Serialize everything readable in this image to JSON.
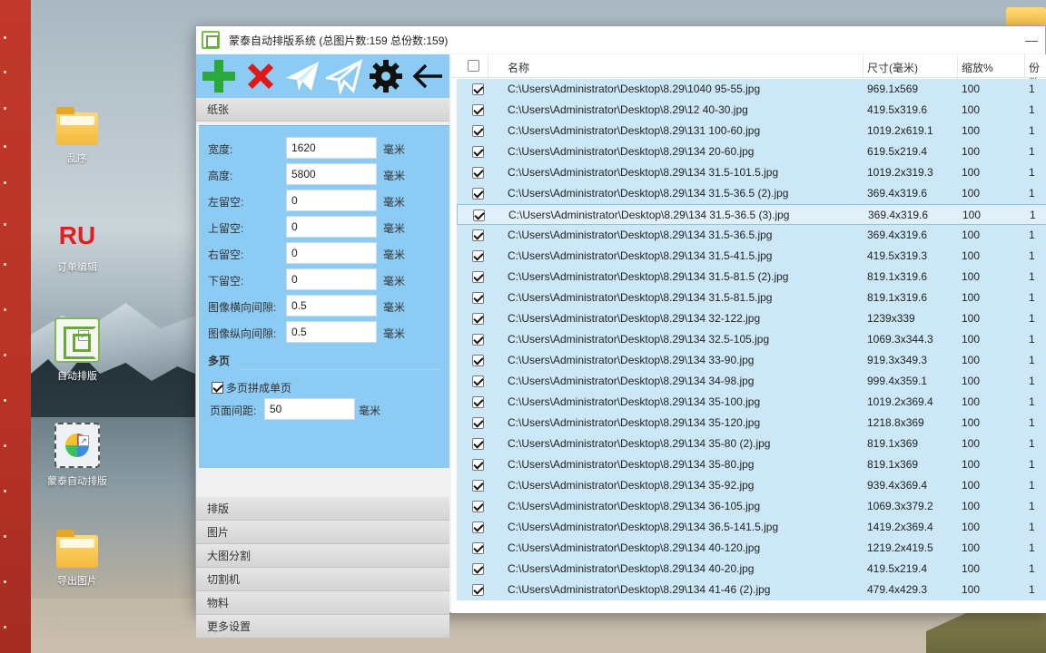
{
  "window": {
    "title": "蒙泰自动排版系统 (总图片数:159 总份数:159)",
    "minimize_glyph": "—"
  },
  "toolbar": {
    "buttons": [
      {
        "icon": "plus-icon",
        "color": "#2aa83a"
      },
      {
        "icon": "close-x-icon",
        "color": "#e01818"
      },
      {
        "icon": "send-icon",
        "color": "#ffffff"
      },
      {
        "icon": "send-outline-icon",
        "color": "#ffffff"
      },
      {
        "icon": "gear-icon",
        "color": "#111111"
      },
      {
        "icon": "arrow-left-icon",
        "color": "#111111"
      }
    ]
  },
  "paper": {
    "header": "纸张",
    "fields": [
      {
        "label": "宽度:",
        "value": "1620",
        "unit": "毫米"
      },
      {
        "label": "高度:",
        "value": "5800",
        "unit": "毫米"
      },
      {
        "label": "左留空:",
        "value": "0",
        "unit": "毫米"
      },
      {
        "label": "上留空:",
        "value": "0",
        "unit": "毫米"
      },
      {
        "label": "右留空:",
        "value": "0",
        "unit": "毫米"
      },
      {
        "label": "下留空:",
        "value": "0",
        "unit": "毫米"
      },
      {
        "label": "图像横向间隙:",
        "value": "0.5",
        "unit": "毫米"
      },
      {
        "label": "图像纵向间隙:",
        "value": "0.5",
        "unit": "毫米"
      }
    ],
    "multipage": {
      "title": "多页",
      "checkbox_label": "多页拼成单页",
      "checked": true,
      "gap_label": "页面间距:",
      "gap_value": "50",
      "gap_unit": "毫米"
    }
  },
  "sections": [
    "排版",
    "图片",
    "大图分割",
    "切割机",
    "物料",
    "更多设置"
  ],
  "list": {
    "headers": {
      "name": "名称",
      "size": "尺寸(毫米)",
      "scale": "缩放%",
      "copies": "份数"
    },
    "rows": [
      {
        "name": "C:\\Users\\Administrator\\Desktop\\8.29\\1040 95-55.jpg",
        "size": "969.1x569",
        "scale": "100",
        "copies": "1"
      },
      {
        "name": "C:\\Users\\Administrator\\Desktop\\8.29\\12 40-30.jpg",
        "size": "419.5x319.6",
        "scale": "100",
        "copies": "1"
      },
      {
        "name": "C:\\Users\\Administrator\\Desktop\\8.29\\131 100-60.jpg",
        "size": "1019.2x619.1",
        "scale": "100",
        "copies": "1"
      },
      {
        "name": "C:\\Users\\Administrator\\Desktop\\8.29\\134 20-60.jpg",
        "size": "619.5x219.4",
        "scale": "100",
        "copies": "1"
      },
      {
        "name": "C:\\Users\\Administrator\\Desktop\\8.29\\134 31.5-101.5.jpg",
        "size": "1019.2x319.3",
        "scale": "100",
        "copies": "1"
      },
      {
        "name": "C:\\Users\\Administrator\\Desktop\\8.29\\134 31.5-36.5 (2).jpg",
        "size": "369.4x319.6",
        "scale": "100",
        "copies": "1"
      },
      {
        "name": "C:\\Users\\Administrator\\Desktop\\8.29\\134 31.5-36.5 (3).jpg",
        "size": "369.4x319.6",
        "scale": "100",
        "copies": "1"
      },
      {
        "name": "C:\\Users\\Administrator\\Desktop\\8.29\\134 31.5-36.5.jpg",
        "size": "369.4x319.6",
        "scale": "100",
        "copies": "1"
      },
      {
        "name": "C:\\Users\\Administrator\\Desktop\\8.29\\134 31.5-41.5.jpg",
        "size": "419.5x319.3",
        "scale": "100",
        "copies": "1"
      },
      {
        "name": "C:\\Users\\Administrator\\Desktop\\8.29\\134 31.5-81.5 (2).jpg",
        "size": "819.1x319.6",
        "scale": "100",
        "copies": "1"
      },
      {
        "name": "C:\\Users\\Administrator\\Desktop\\8.29\\134 31.5-81.5.jpg",
        "size": "819.1x319.6",
        "scale": "100",
        "copies": "1"
      },
      {
        "name": "C:\\Users\\Administrator\\Desktop\\8.29\\134 32-122.jpg",
        "size": "1239x339",
        "scale": "100",
        "copies": "1"
      },
      {
        "name": "C:\\Users\\Administrator\\Desktop\\8.29\\134 32.5-105.jpg",
        "size": "1069.3x344.3",
        "scale": "100",
        "copies": "1"
      },
      {
        "name": "C:\\Users\\Administrator\\Desktop\\8.29\\134 33-90.jpg",
        "size": "919.3x349.3",
        "scale": "100",
        "copies": "1"
      },
      {
        "name": "C:\\Users\\Administrator\\Desktop\\8.29\\134 34-98.jpg",
        "size": "999.4x359.1",
        "scale": "100",
        "copies": "1"
      },
      {
        "name": "C:\\Users\\Administrator\\Desktop\\8.29\\134 35-100.jpg",
        "size": "1019.2x369.4",
        "scale": "100",
        "copies": "1"
      },
      {
        "name": "C:\\Users\\Administrator\\Desktop\\8.29\\134 35-120.jpg",
        "size": "1218.8x369",
        "scale": "100",
        "copies": "1"
      },
      {
        "name": "C:\\Users\\Administrator\\Desktop\\8.29\\134 35-80 (2).jpg",
        "size": "819.1x369",
        "scale": "100",
        "copies": "1"
      },
      {
        "name": "C:\\Users\\Administrator\\Desktop\\8.29\\134 35-80.jpg",
        "size": "819.1x369",
        "scale": "100",
        "copies": "1"
      },
      {
        "name": "C:\\Users\\Administrator\\Desktop\\8.29\\134 35-92.jpg",
        "size": "939.4x369.4",
        "scale": "100",
        "copies": "1"
      },
      {
        "name": "C:\\Users\\Administrator\\Desktop\\8.29\\134 36-105.jpg",
        "size": "1069.3x379.2",
        "scale": "100",
        "copies": "1"
      },
      {
        "name": "C:\\Users\\Administrator\\Desktop\\8.29\\134 36.5-141.5.jpg",
        "size": "1419.2x369.4",
        "scale": "100",
        "copies": "1"
      },
      {
        "name": "C:\\Users\\Administrator\\Desktop\\8.29\\134 40-120.jpg",
        "size": "1219.2x419.5",
        "scale": "100",
        "copies": "1"
      },
      {
        "name": "C:\\Users\\Administrator\\Desktop\\8.29\\134 40-20.jpg",
        "size": "419.5x219.4",
        "scale": "100",
        "copies": "1"
      },
      {
        "name": "C:\\Users\\Administrator\\Desktop\\8.29\\134 41-46 (2).jpg",
        "size": "479.4x429.3",
        "scale": "100",
        "copies": "1"
      }
    ]
  },
  "desktop": {
    "icons": [
      {
        "label": "乱序",
        "icon": "folder-icon"
      },
      {
        "label": "RU",
        "sub": "订单编辑",
        "icon": "ru-app-icon"
      },
      {
        "label": "自动排版",
        "icon": "auto-layout-app-icon"
      },
      {
        "label": "蒙泰自动排版",
        "icon": "mengtai-app-icon"
      },
      {
        "label": "导出图片",
        "icon": "folder-icon"
      }
    ]
  },
  "colors": {
    "toolbar_bg": "#8ccbf3",
    "row_bg": "#cce8f7",
    "taskbar_red": "#c0392b"
  }
}
